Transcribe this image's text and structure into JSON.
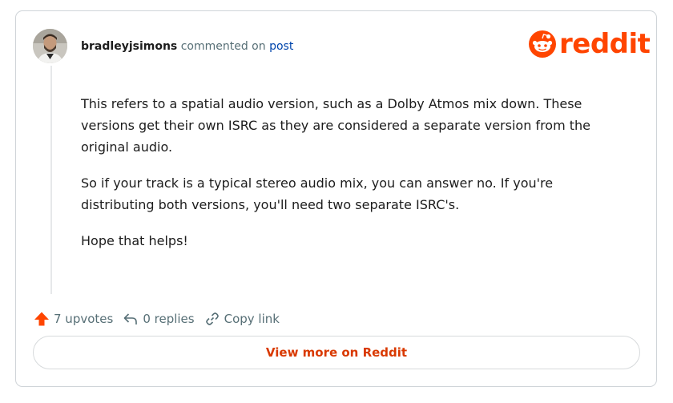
{
  "comment": {
    "author": "bradleyjsimons",
    "action_text": "commented on",
    "target_link": "post",
    "paragraphs": [
      "This refers to a spatial audio version, such as a Dolby Atmos mix down. These versions get their own ISRC as they are considered a separate version from the original audio.",
      "So if your track is a typical stereo audio mix, you can answer no. If you're distributing both versions, you'll need two separate ISRC's.",
      "Hope that helps!"
    ]
  },
  "logo": {
    "wordmark": "reddit",
    "brand_color": "#ff4500"
  },
  "actions": {
    "upvotes": "7 upvotes",
    "replies": "0 replies",
    "copy_link": "Copy link",
    "icons": [
      "upvote-arrow-icon",
      "reply-icon",
      "link-icon"
    ]
  },
  "view_more": {
    "label": "View more on Reddit",
    "color": "#d93900"
  }
}
